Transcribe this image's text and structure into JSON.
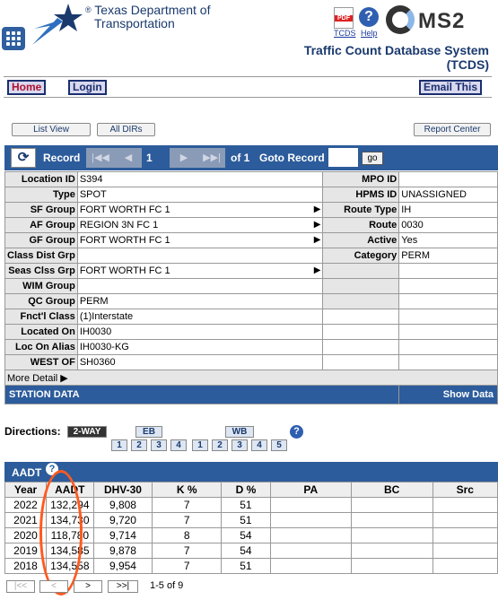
{
  "header": {
    "org_line1": "Texas Department of",
    "org_line2": "Transportation",
    "reg": "®",
    "pdf_label": "TCDS",
    "help_label": "Help",
    "ms2_label": "MS2",
    "title_line1": "Traffic Count Database System",
    "title_line2": "(TCDS)"
  },
  "nav": {
    "home": "Home",
    "login": "Login",
    "email": "Email This"
  },
  "subnav": {
    "list_view": "List View",
    "all_dirs": "All DIRs",
    "report_center": "Report Center"
  },
  "record": {
    "label": "Record",
    "number": "1",
    "of": "of 1",
    "goto": "Goto Record",
    "go": "go"
  },
  "fields": {
    "location_id_l": "Location ID",
    "location_id": "S394",
    "mpo_id_l": "MPO ID",
    "mpo_id": "",
    "type_l": "Type",
    "type": "SPOT",
    "hpms_id_l": "HPMS ID",
    "hpms_id": "UNASSIGNED",
    "sf_group_l": "SF Group",
    "sf_group": "FORT WORTH FC 1",
    "route_type_l": "Route Type",
    "route_type": "IH",
    "af_group_l": "AF Group",
    "af_group": "REGION 3N FC 1",
    "route_l": "Route",
    "route": "0030",
    "gf_group_l": "GF Group",
    "gf_group": "FORT WORTH FC 1",
    "active_l": "Active",
    "active": "Yes",
    "class_dist_l": "Class Dist Grp",
    "class_dist": "",
    "category_l": "Category",
    "category": "PERM",
    "seas_clss_l": "Seas Clss Grp",
    "seas_clss": "FORT WORTH FC 1",
    "wim_l": "WIM Group",
    "wim": "",
    "qc_l": "QC Group",
    "qc": "PERM",
    "fnct_l": "Fnct'l Class",
    "fnct": "(1)Interstate",
    "located_on_l": "Located On",
    "located_on": "IH0030",
    "loc_alias_l": "Loc On Alias",
    "loc_alias": "IH0030-KG",
    "west_of_l": "WEST OF",
    "west_of": "SH0360",
    "more_detail": "More Detail"
  },
  "station": {
    "title": "STATION DATA",
    "show": "Show Data"
  },
  "directions": {
    "label": "Directions:",
    "two_way": "2-WAY",
    "eb": "EB",
    "wb": "WB",
    "lanes": [
      "1",
      "2",
      "3",
      "4",
      "1",
      "2",
      "3",
      "4",
      "5"
    ]
  },
  "aadt": {
    "title": "AADT",
    "columns": [
      "Year",
      "AADT",
      "DHV-30",
      "K %",
      "D %",
      "PA",
      "BC",
      "Src"
    ],
    "rows": [
      [
        "2022",
        "132,294",
        "9,808",
        "7",
        "51",
        "",
        "",
        ""
      ],
      [
        "2021",
        "134,730",
        "9,720",
        "7",
        "51",
        "",
        "",
        ""
      ],
      [
        "2020",
        "118,780",
        "9,714",
        "8",
        "54",
        "",
        "",
        ""
      ],
      [
        "2019",
        "134,585",
        "9,878",
        "7",
        "54",
        "",
        "",
        ""
      ],
      [
        "2018",
        "134,558",
        "9,954",
        "7",
        "51",
        "",
        "",
        ""
      ]
    ]
  },
  "pager": {
    "first": "|<<",
    "prev": "<",
    "next": ">",
    "last": ">>|",
    "status": "1-5 of 9"
  },
  "colors": {
    "blue_bar": "#2c5c9b",
    "brand": "#1a3a6e",
    "annotation": "#ff5a1f"
  }
}
